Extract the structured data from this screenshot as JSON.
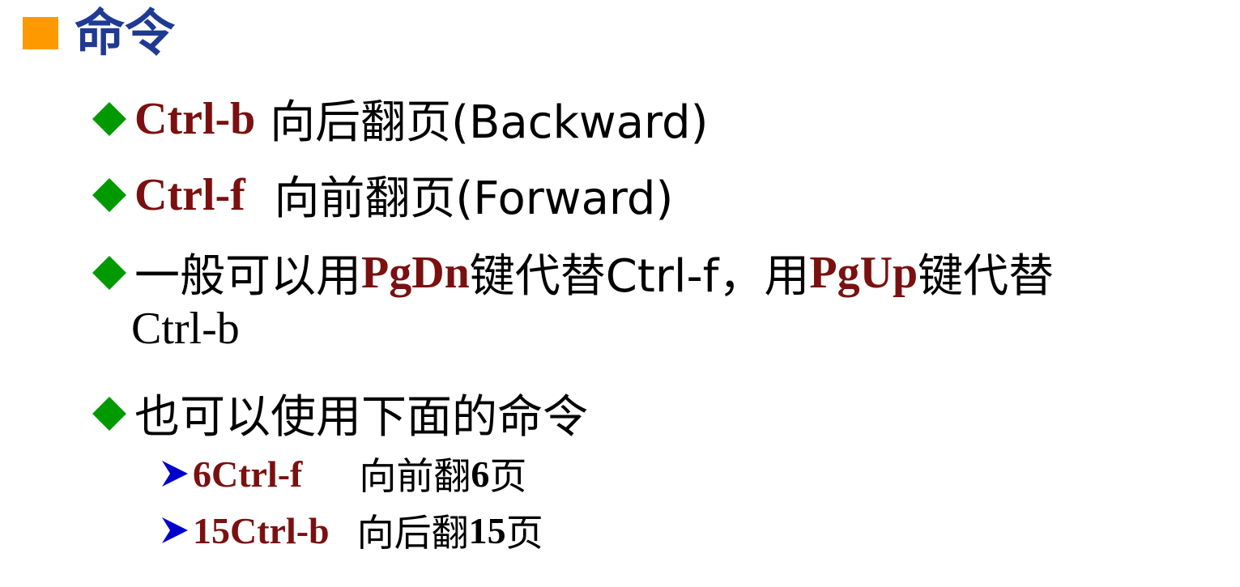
{
  "heading": {
    "title": "命令",
    "square_color": "#ff9900",
    "title_color": "#1f3a93"
  },
  "bullets": [
    {
      "key": "Ctrl-b",
      "text": " 向后翻页(Backward)"
    },
    {
      "key": "Ctrl-f",
      "text": "  向前翻页(Forward)"
    },
    {
      "prefix": "一般可以用",
      "key1": "PgDn",
      "mid": "键代替Ctrl-f，用",
      "key2": "PgUp",
      "suffix": "键代替",
      "continuation": "Ctrl-b"
    },
    {
      "text": "也可以使用下面的命令"
    }
  ],
  "sub_bullets": [
    {
      "key": "6Ctrl-f",
      "text_before": "向前翻",
      "number": "6",
      "text_after": "页"
    },
    {
      "key": "15Ctrl-b",
      "text_before": "向后翻",
      "number": "15",
      "text_after": "页"
    }
  ],
  "colors": {
    "bullet_diamond": "#009900",
    "key_text": "#7b1010",
    "sub_arrow": "#0000cc"
  },
  "icons": {
    "heading_bullet": "square-bullet-icon",
    "bullet": "diamond-bullet-icon",
    "sub_bullet": "arrow-bullet-icon"
  }
}
